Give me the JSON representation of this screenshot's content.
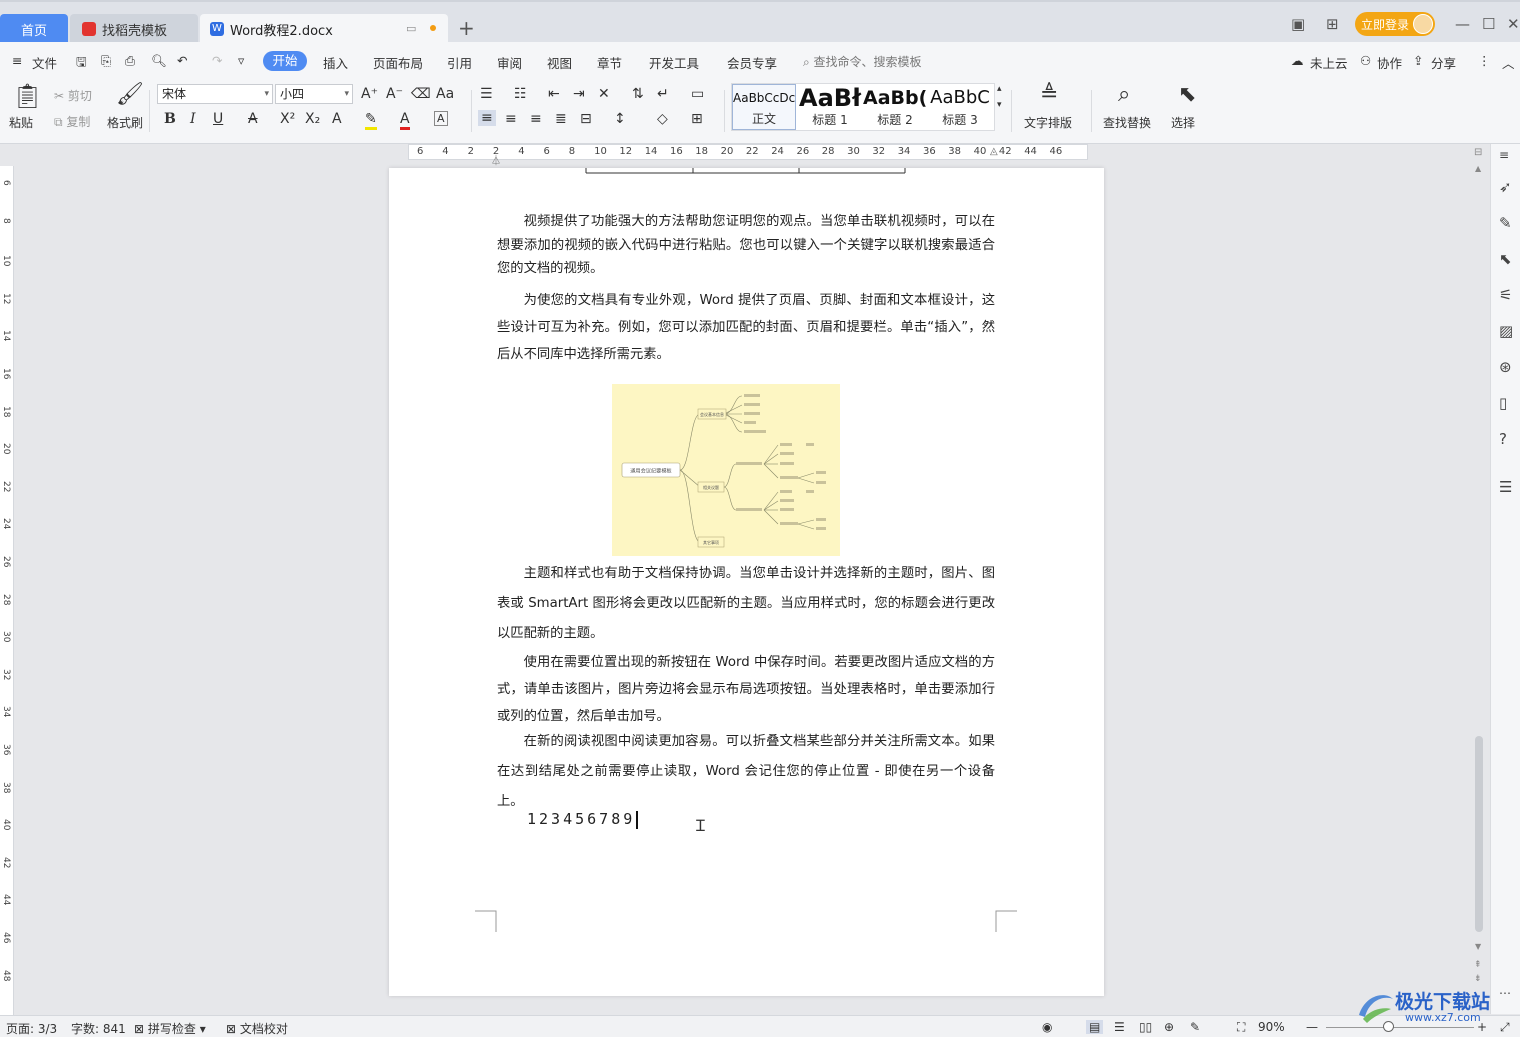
{
  "tabs": {
    "home": "首页",
    "template": "找稻壳模板",
    "document": "Word教程2.docx",
    "new_tab": "+"
  },
  "titlebar": {
    "login": "立即登录"
  },
  "menu": {
    "file": "文件",
    "items": [
      "开始",
      "插入",
      "页面布局",
      "引用",
      "审阅",
      "视图",
      "章节",
      "开发工具",
      "会员专享"
    ],
    "search_placeholder": "查找命令、搜索模板",
    "cloud": "未上云",
    "collab": "协作",
    "share": "分享"
  },
  "ribbon": {
    "paste": "粘贴",
    "cut": "剪切",
    "copy": "复制",
    "format_painter": "格式刷",
    "font_name": "宋体",
    "font_size": "小四",
    "styles": [
      {
        "sample": "AaBbCcDc",
        "label": "正文"
      },
      {
        "sample": "AaBł",
        "label": "标题 1"
      },
      {
        "sample": "AaBb(",
        "label": "标题 2"
      },
      {
        "sample": "AaBbC",
        "label": "标题 3"
      }
    ],
    "text_layout": "文字排版",
    "find_replace": "查找替换",
    "select": "选择"
  },
  "ruler": {
    "ticks": [
      "6",
      "4",
      "2",
      "2",
      "4",
      "6",
      "8",
      "10",
      "12",
      "14",
      "16",
      "18",
      "20",
      "22",
      "24",
      "26",
      "28",
      "30",
      "32",
      "34",
      "36",
      "38",
      "40",
      "42",
      "44",
      "46"
    ],
    "vticks": [
      "6",
      "8",
      "10",
      "12",
      "14",
      "16",
      "18",
      "20",
      "22",
      "24",
      "26",
      "28",
      "30",
      "32",
      "34",
      "36",
      "38",
      "40",
      "42",
      "44",
      "46",
      "48"
    ]
  },
  "document": {
    "paragraphs": [
      "视频提供了功能强大的方法帮助您证明您的观点。当您单击联机视频时，可以在想要添加的视频的嵌入代码中进行粘贴。您也可以键入一个关键字以联机搜索最适合您的文档的视频。",
      "为使您的文档具有专业外观，Word 提供了页眉、页脚、封面和文本框设计，这些设计可互为补充。例如，您可以添加匹配的封面、页眉和提要栏。单击“插入”，然后从不同库中选择所需元素。",
      "主题和样式也有助于文档保持协调。当您单击设计并选择新的主题时，图片、图表或 SmartArt 图形将会更改以匹配新的主题。当应用样式时，您的标题会进行更改以匹配新的主题。",
      "使用在需要位置出现的新按钮在 Word 中保存时间。若要更改图片适应文档的方式，请单击该图片，图片旁边将会显示布局选项按钮。当处理表格时，单击要添加行或列的位置，然后单击加号。",
      "在新的阅读视图中阅读更加容易。可以折叠文档某些部分并关注所需文本。如果在达到结尾处之前需要停止读取，Word 会记住您的停止位置 - 即使在另一个设备上。"
    ],
    "number_line": "123456789",
    "mindmap_root": "通用会议纪要模板",
    "mindmap_b1": "会议基本信息",
    "mindmap_b2": "相关议题",
    "mindmap_b3": "其它事项"
  },
  "status": {
    "page": "页面: 3/3",
    "words": "字数: 841",
    "spell": "拼写检查",
    "proof": "文档校对",
    "zoom": "90%"
  },
  "watermark": {
    "text": "极光下载站",
    "url": "www.xz7.com"
  }
}
